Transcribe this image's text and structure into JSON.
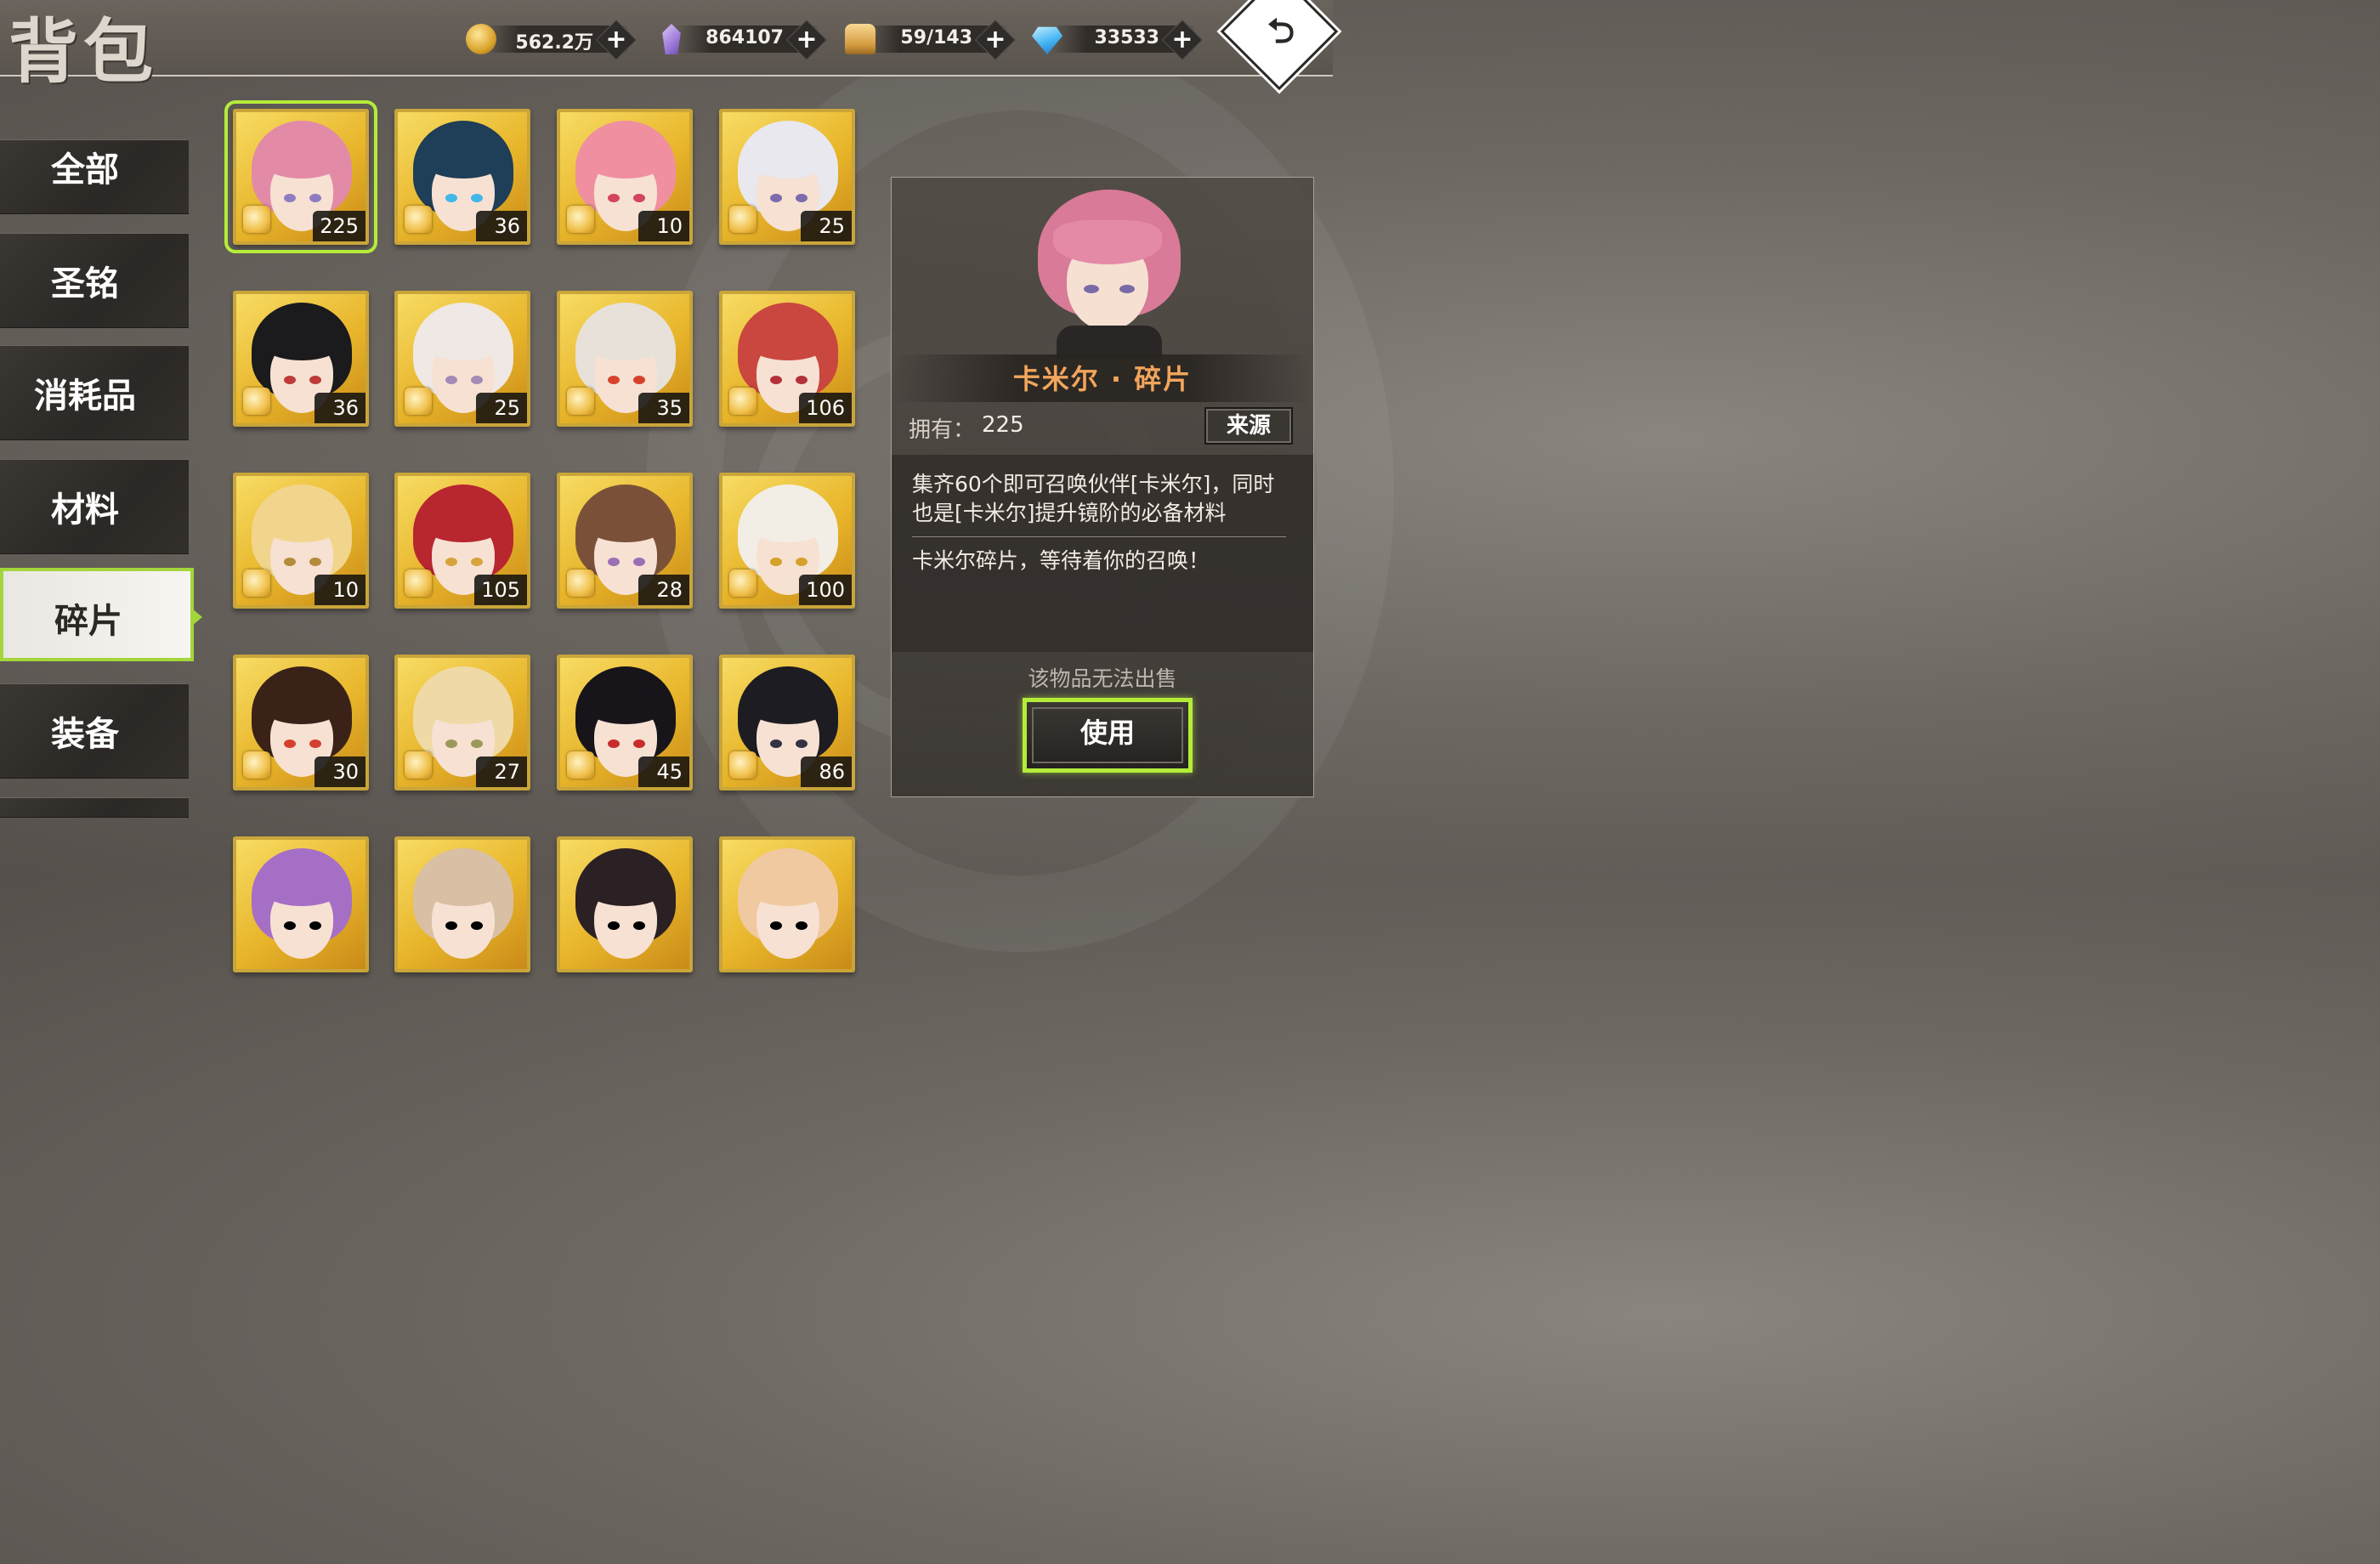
{
  "header": {
    "title": "背包",
    "resources": [
      {
        "icon": "gold-coin-icon",
        "value": "562.2万"
      },
      {
        "icon": "purple-crystal-icon",
        "value": "864107"
      },
      {
        "icon": "bread-stamina-icon",
        "value": "59/143"
      },
      {
        "icon": "diamond-gem-icon",
        "value": "33533"
      }
    ],
    "plus": "+",
    "back_icon": "back-arrow-icon",
    "back_glyph": "⮌"
  },
  "sidebar": {
    "items": [
      {
        "label": "全部",
        "active": false
      },
      {
        "label": "圣铭",
        "active": false
      },
      {
        "label": "消耗品",
        "active": false
      },
      {
        "label": "材料",
        "active": false
      },
      {
        "label": "碎片",
        "active": true
      },
      {
        "label": "装备",
        "active": false
      }
    ]
  },
  "grid": {
    "items": [
      {
        "count": "225",
        "hair": "#e38aa7",
        "eye": "#8f7cc0",
        "selected": true
      },
      {
        "count": "36",
        "hair": "#1f3e57",
        "eye": "#41b7e8",
        "selected": false
      },
      {
        "count": "10",
        "hair": "#ef8fa0",
        "eye": "#d2455a",
        "selected": false
      },
      {
        "count": "25",
        "hair": "#e8e8ee",
        "eye": "#7c6cae",
        "selected": false
      },
      {
        "count": "36",
        "hair": "#1b1a1d",
        "eye": "#c03a3a",
        "selected": false
      },
      {
        "count": "25",
        "hair": "#efe8e4",
        "eye": "#a48ab6",
        "selected": false
      },
      {
        "count": "35",
        "hair": "#e7e1da",
        "eye": "#d7412b",
        "selected": false
      },
      {
        "count": "106",
        "hair": "#c9473e",
        "eye": "#b3323a",
        "selected": false
      },
      {
        "count": "10",
        "hair": "#f2d58c",
        "eye": "#b48a3b",
        "selected": false
      },
      {
        "count": "105",
        "hair": "#b8262f",
        "eye": "#d6a33c",
        "selected": false
      },
      {
        "count": "28",
        "hair": "#7a5138",
        "eye": "#9c6fb4",
        "selected": false
      },
      {
        "count": "100",
        "hair": "#f2eee6",
        "eye": "#d4a129",
        "selected": false
      },
      {
        "count": "30",
        "hair": "#3b2218",
        "eye": "#d4402e",
        "selected": false
      },
      {
        "count": "27",
        "hair": "#efd9a6",
        "eye": "#9c9858",
        "selected": false
      },
      {
        "count": "45",
        "hair": "#17151a",
        "eye": "#c92c2c",
        "selected": false
      },
      {
        "count": "86",
        "hair": "#1d1c22",
        "eye": "#333344",
        "selected": false
      },
      {
        "count": "",
        "hair": "#a66fc6",
        "eye": "#000000",
        "selected": false
      },
      {
        "count": "",
        "hair": "#d9bfa3",
        "eye": "#000000",
        "selected": false
      },
      {
        "count": "",
        "hair": "#2b2023",
        "eye": "#000000",
        "selected": false
      },
      {
        "count": "",
        "hair": "#f0c9a0",
        "eye": "#000000",
        "selected": false
      }
    ]
  },
  "detail": {
    "name": "卡米尔 · 碎片",
    "own_label": "拥有：",
    "own_value": "225",
    "source_label": "来源",
    "description": "集齐60个即可召唤伙伴[卡米尔]，同时也是[卡米尔]提升镜阶的必备材料",
    "flavor": "卡米尔碎片，等待着你的召唤！",
    "no_sell": "该物品无法出售",
    "use_label": "使用"
  }
}
